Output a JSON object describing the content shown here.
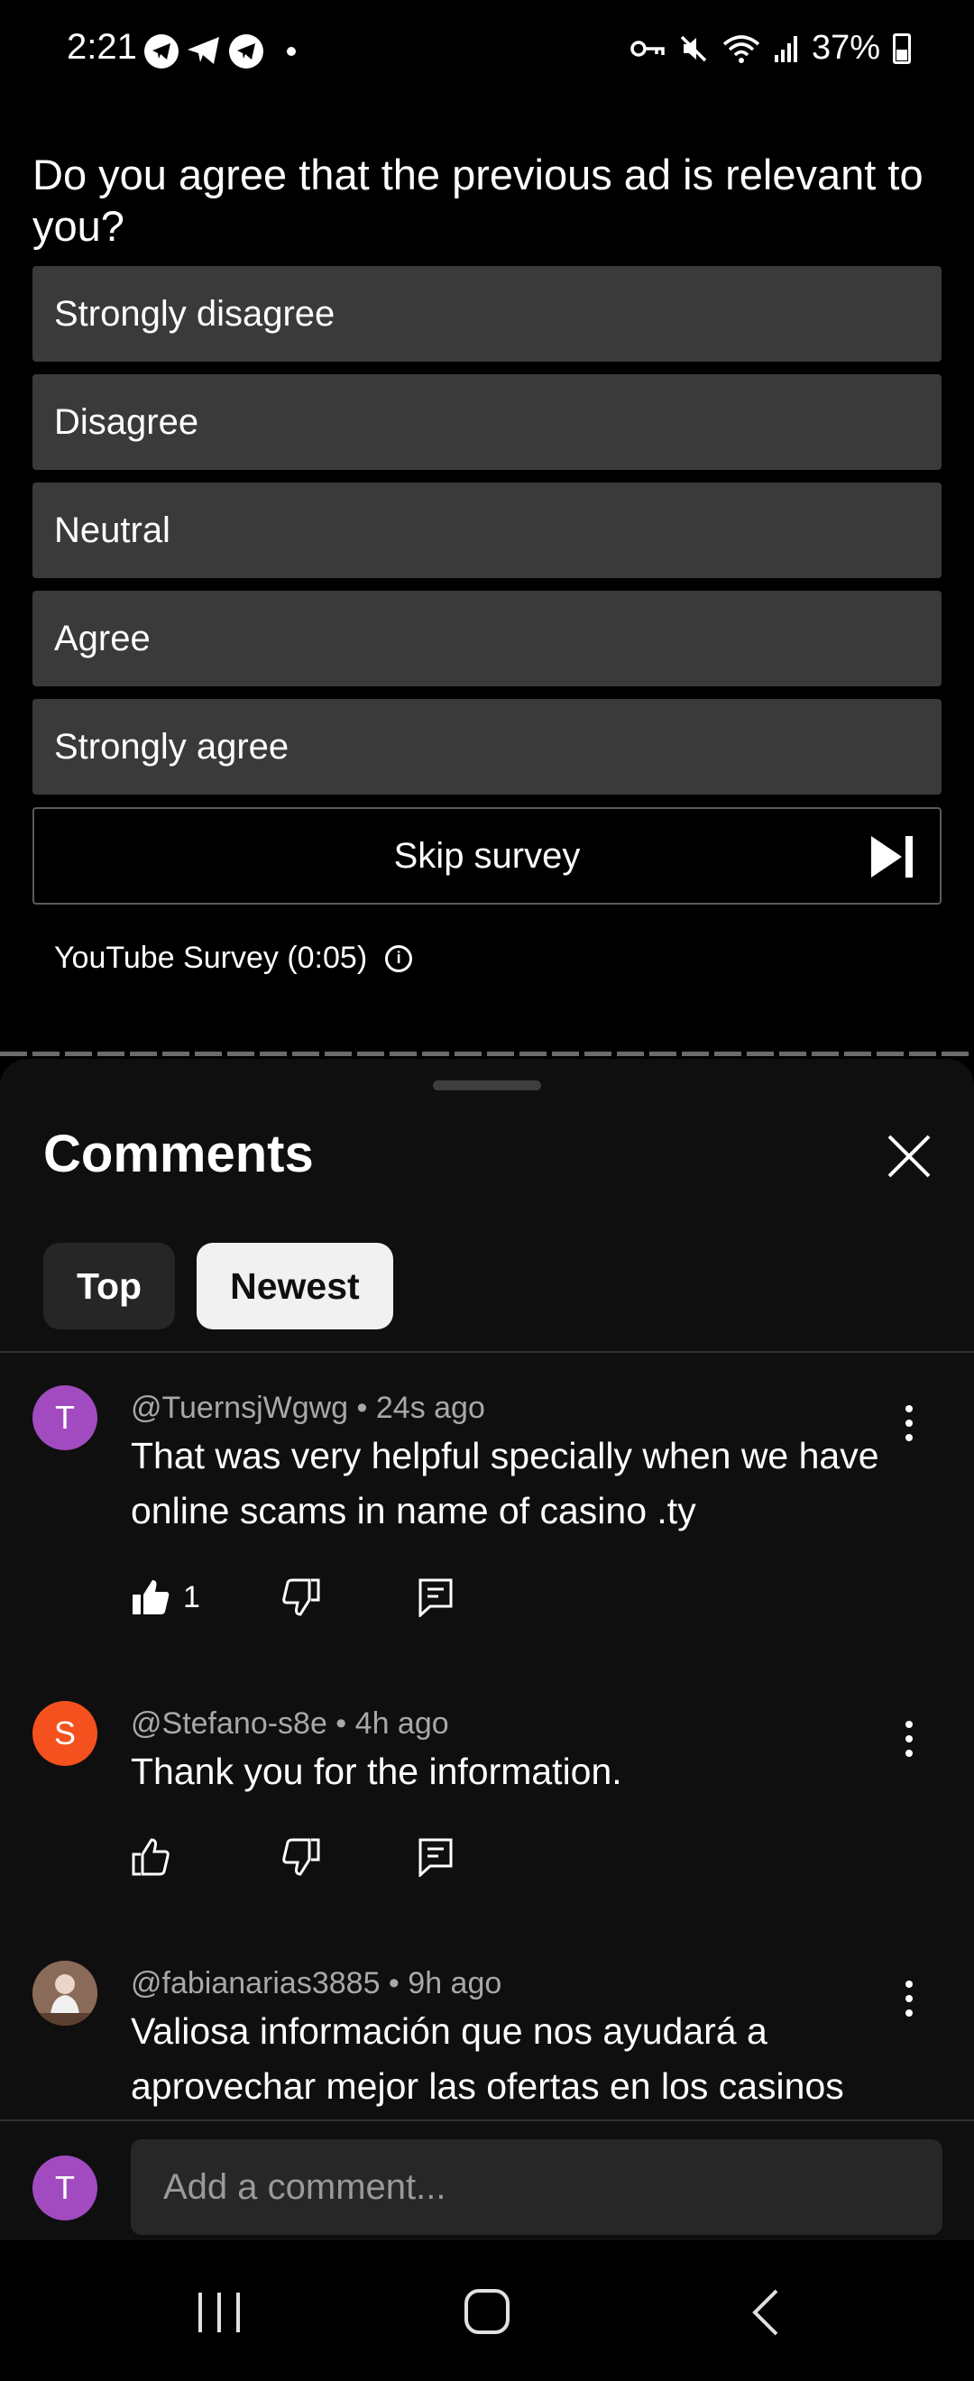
{
  "status_bar": {
    "time": "2:21",
    "battery": "37%",
    "icons": [
      "telegram-icon",
      "telegram-icon",
      "telegram-icon",
      "notification-dot",
      "vpn-key-icon",
      "mute-icon",
      "wifi-icon",
      "signal-icon",
      "battery-icon"
    ]
  },
  "survey": {
    "question": "Do you agree that the previous ad is relevant to you?",
    "options": [
      "Strongly disagree",
      "Disagree",
      "Neutral",
      "Agree",
      "Strongly agree"
    ],
    "skip_label": "Skip survey",
    "footer": "YouTube Survey (0:05)"
  },
  "comments_panel": {
    "title": "Comments",
    "tabs": [
      {
        "label": "Top",
        "selected": false
      },
      {
        "label": "Newest",
        "selected": true
      }
    ],
    "comments": [
      {
        "avatar_letter": "T",
        "avatar_color": "#a24bc0",
        "meta": "@TuernsjWgwg • 24s ago",
        "text": "That was very helpful specially when we have online scams in name of casino .ty",
        "likes": "1"
      },
      {
        "avatar_letter": "S",
        "avatar_color": "#f4511e",
        "meta": "@Stefano-s8e • 4h ago",
        "text": "Thank you for the information.",
        "likes": ""
      },
      {
        "avatar_letter": "",
        "avatar_color": "#7a5a48",
        "meta": "@fabianarias3885 • 9h ago",
        "text": "Valiosa información que nos ayudará a aprovechar mejor las ofertas en los casinos",
        "likes": ""
      }
    ],
    "input": {
      "avatar_letter": "T",
      "placeholder": "Add a comment..."
    }
  },
  "colors": {
    "sheet_bg": "#0f0f0f",
    "option_bg": "#3a3a3a",
    "chip_selected_bg": "#f1f1f1"
  }
}
